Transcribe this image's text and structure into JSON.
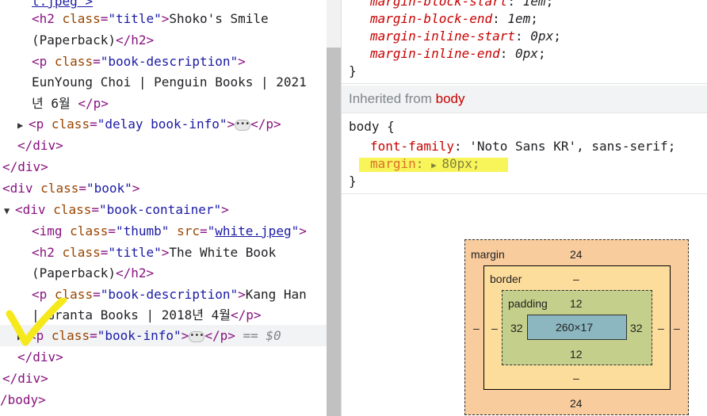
{
  "elements_panel": {
    "lines": [
      {
        "tag_open": "<h2 ",
        "attr": "class",
        "eq": "=",
        "val": "\"title\"",
        "close": ">",
        "text": "Shoko's Smile"
      },
      {
        "text": "(Paperback)",
        "tag_close": "</h2>"
      },
      {
        "tag_open": "<p ",
        "attr": "class",
        "eq": "=",
        "val": "\"book-description\"",
        "close": ">"
      },
      {
        "text": "EunYoung Choi | Penguin Books | 2021"
      },
      {
        "text": "년 6월 ",
        "tag_close": "</p>"
      },
      {
        "tri": "▶",
        "tag_open": "<p ",
        "attr": "class",
        "eq": "=",
        "val": "\"delay book-info\"",
        "close": ">",
        "ellipsis": "•••",
        "tag_close": "</p>"
      },
      {
        "tag_close": "</div>"
      },
      {
        "tag_close": "</div>"
      },
      {
        "tag_open": "<div ",
        "attr": "class",
        "eq": "=",
        "val": "\"book\"",
        "close": ">"
      },
      {
        "tri": "▼",
        "tag_open": "<div ",
        "attr": "class",
        "eq": "=",
        "val": "\"book-container\"",
        "close": ">"
      },
      {
        "tag_open": "<img ",
        "attr": "class",
        "eq": "=",
        "val": "\"thumb\"",
        "attr2": "src",
        "eq2": "=",
        "link": "white.jpeg",
        "close": ">"
      },
      {
        "tag_open": "<h2 ",
        "attr": "class",
        "eq": "=",
        "val": "\"title\"",
        "close": ">",
        "text": "The White Book"
      },
      {
        "text": "(Paperback)",
        "tag_close": "</h2>"
      },
      {
        "tag_open": "<p ",
        "attr": "class",
        "eq": "=",
        "val": "\"book-description\"",
        "close": ">",
        "text": "Kang Han"
      },
      {
        "text": "| Granta Books | 2018년 4월",
        "tag_close": "</p>"
      },
      {
        "tri": "▶",
        "tag_open": "<p ",
        "attr": "class",
        "eq": "=",
        "val": "\"book-info\"",
        "close": ">",
        "ellipsis": "•••",
        "tag_close": "</p>",
        "dollar": "== $0"
      },
      {
        "tag_close": "</div>"
      },
      {
        "tag_close": "</div>"
      },
      {
        "tag_close": "/body>"
      }
    ],
    "top_partial": "t.jpeg\">"
  },
  "styles_panel": {
    "top_rules": [
      {
        "prop": "margin-block-start",
        "value": "1em"
      },
      {
        "prop": "margin-block-end",
        "value": "1em"
      },
      {
        "prop": "margin-inline-start",
        "value": "0px"
      },
      {
        "prop": "margin-inline-end",
        "value": "0px"
      }
    ],
    "close_brace": "}",
    "inherited_label": "Inherited from",
    "inherited_source": "body",
    "body_selector": "body {",
    "body_rules": [
      {
        "prop": "font-family",
        "value": "'Noto Sans KR', sans-serif"
      },
      {
        "prop": "margin",
        "value": "80px",
        "inactive": true
      }
    ],
    "body_close": "}"
  },
  "box_model": {
    "margin_label": "margin",
    "margin_top": "24",
    "margin_bottom": "24",
    "margin_left": "–",
    "margin_right": "–",
    "border_label": "border",
    "border_top": "–",
    "border_bottom": "–",
    "border_left": "–",
    "border_right": "–",
    "padding_label": "padding",
    "padding_top": "12",
    "padding_bottom": "12",
    "padding_left": "32",
    "padding_right": "32",
    "content": "260×17"
  },
  "colors": {
    "tag": "#881280",
    "attr": "#994500",
    "value": "#1a1aa6",
    "property": "#c80000",
    "highlight": "#f8f55b"
  }
}
